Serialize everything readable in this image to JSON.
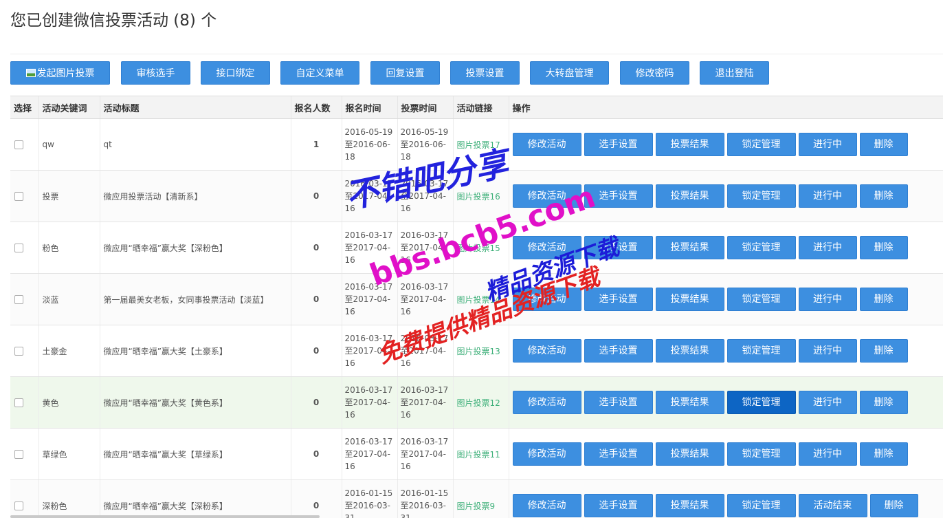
{
  "title": "您已创建微信投票活动 (8) 个",
  "toolbar": {
    "create_photo_vote": "发起图片投票",
    "review_contestants": "审核选手",
    "interface_binding": "接口绑定",
    "custom_menu": "自定义菜单",
    "reply_settings": "回复设置",
    "vote_settings": "投票设置",
    "wheel_management": "大转盘管理",
    "change_password": "修改密码",
    "logout": "退出登陆"
  },
  "table": {
    "headers": {
      "select": "选择",
      "keyword": "活动关键词",
      "title": "活动标题",
      "signups": "报名人数",
      "signup_time": "报名时间",
      "vote_time": "投票时间",
      "link": "活动链接",
      "actions": "操作"
    },
    "actions": {
      "edit": "修改活动",
      "contestants": "选手设置",
      "results": "投票结果",
      "lock": "锁定管理",
      "delete": "删除"
    },
    "rows": [
      {
        "keyword": "qw",
        "title": "qt",
        "count": "1",
        "signup": "2016-05-19\n至2016-06-\n18",
        "vote": "2016-05-19\n至2016-06-\n18",
        "link": "图片投票17",
        "status": "进行中"
      },
      {
        "keyword": "投票",
        "title": "微应用投票活动【清新系】",
        "count": "0",
        "signup": "2016-03-17\n至2017-04-\n16",
        "vote": "2016-03-17\n至2017-04-\n16",
        "link": "图片投票16",
        "status": "进行中"
      },
      {
        "keyword": "粉色",
        "title": "微应用“晒幸福”赢大奖【深粉色】",
        "count": "0",
        "signup": "2016-03-17\n至2017-04-\n16",
        "vote": "2016-03-17\n至2017-04-\n16",
        "link": "图片投票15",
        "status": "进行中"
      },
      {
        "keyword": "淡蓝",
        "title": "第一届最美女老板，女同事投票活动【淡蓝】",
        "count": "0",
        "signup": "2016-03-17\n至2017-04-\n16",
        "vote": "2016-03-17\n至2017-04-\n16",
        "link": "图片投票14",
        "status": "进行中"
      },
      {
        "keyword": "土豪金",
        "title": "微应用“晒幸福”赢大奖【土豪系】",
        "count": "0",
        "signup": "2016-03-17\n至2017-04-\n16",
        "vote": "2016-03-17\n至2017-04-\n16",
        "link": "图片投票13",
        "status": "进行中"
      },
      {
        "keyword": "黄色",
        "title": "微应用“晒幸福”赢大奖【黄色系】",
        "count": "0",
        "signup": "2016-03-17\n至2017-04-\n16",
        "vote": "2016-03-17\n至2017-04-\n16",
        "link": "图片投票12",
        "status": "进行中"
      },
      {
        "keyword": "草绿色",
        "title": "微应用“晒幸福”赢大奖【草绿系】",
        "count": "0",
        "signup": "2016-03-17\n至2017-04-\n16",
        "vote": "2016-03-17\n至2017-04-\n16",
        "link": "图片投票11",
        "status": "进行中"
      },
      {
        "keyword": "深粉色",
        "title": "微应用“晒幸福”赢大奖【深粉系】",
        "count": "0",
        "signup": "2016-01-15\n至2016-03-\n31",
        "vote": "2016-01-15\n至2016-03-\n31",
        "link": "图片投票9",
        "status": "活动结束"
      }
    ]
  },
  "watermark": {
    "line1": "不错吧分享",
    "line2": "bbs.bcb5.com",
    "line3": "精品资源下载",
    "line4": "免费提供精品资源下载"
  },
  "colors": {
    "button": "#3d8fe0",
    "button_active": "#0d65c4",
    "link": "#3fb07a",
    "row_highlight": "#eff8ec"
  }
}
